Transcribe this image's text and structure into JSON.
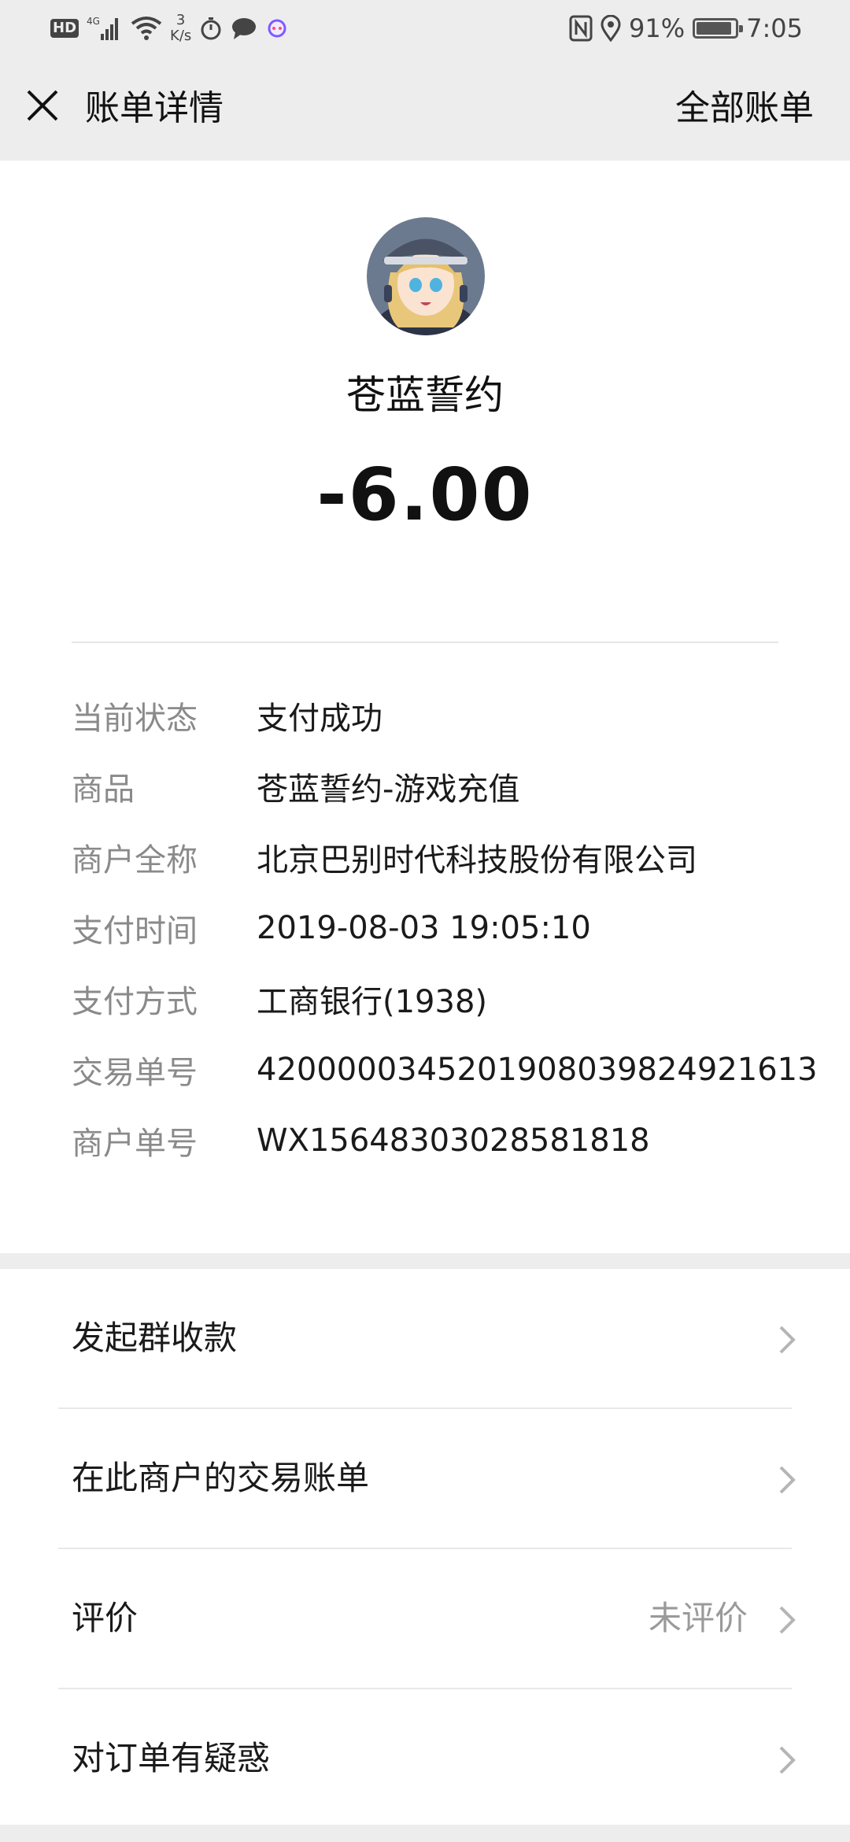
{
  "status_bar": {
    "hd": "HD",
    "network": "4G",
    "speed_value": "3",
    "speed_unit": "K/s",
    "battery": "91%",
    "battery_level": 0.91,
    "time": "7:05"
  },
  "header": {
    "title": "账单详情",
    "right_link": "全部账单"
  },
  "bill": {
    "merchant_name": "苍蓝誓约",
    "amount": "-6.00"
  },
  "details": [
    {
      "label": "当前状态",
      "value": "支付成功"
    },
    {
      "label": "商品",
      "value": "苍蓝誓约-游戏充值"
    },
    {
      "label": "商户全称",
      "value": "北京巴别时代科技股份有限公司"
    },
    {
      "label": "支付时间",
      "value": "2019-08-03 19:05:10"
    },
    {
      "label": "支付方式",
      "value": "工商银行(1938)"
    },
    {
      "label": "交易单号",
      "value": "4200000345201908039824921613"
    },
    {
      "label": "商户单号",
      "value": "WX15648303028581818"
    }
  ],
  "actions": [
    {
      "label": "发起群收款",
      "right": ""
    },
    {
      "label": "在此商户的交易账单",
      "right": ""
    },
    {
      "label": "评价",
      "right": "未评价"
    },
    {
      "label": "对订单有疑惑",
      "right": ""
    }
  ]
}
